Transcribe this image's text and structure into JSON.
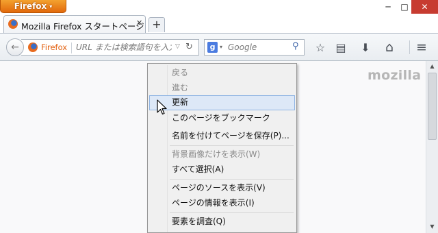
{
  "app_menu": {
    "label": "Firefox",
    "arrow": "▾"
  },
  "window_controls": {
    "minimize": "─",
    "maximize": "□",
    "close": "✕"
  },
  "tabs": [
    {
      "title": "Mozilla Firefox スタートページ",
      "close": "✕",
      "icon": "firefox-icon"
    }
  ],
  "new_tab": "+",
  "navbar": {
    "back": "←",
    "identity_label": "Firefox",
    "url_placeholder": "URL または検索語句を入力",
    "url_dropdown": "▽",
    "reload": "↻",
    "search_engine_letter": "g",
    "search_engine_dropdown": "▾",
    "search_placeholder": "Google",
    "search_go": "⚲",
    "buttons": [
      {
        "name": "bookmark-star",
        "glyph": "☆"
      },
      {
        "name": "bookmarks-menu",
        "glyph": "▤"
      },
      {
        "name": "downloads",
        "glyph": "⬇"
      },
      {
        "name": "home",
        "glyph": "⌂"
      },
      {
        "name": "menu",
        "glyph": "≡"
      }
    ]
  },
  "content": {
    "brand": "mozilla"
  },
  "scrollbar": {
    "up": "▲",
    "down": "▼"
  },
  "context_menu": {
    "items": [
      {
        "label": "戻る",
        "disabled": true
      },
      {
        "label": "進む",
        "disabled": true
      },
      {
        "label": "更新",
        "hover": true
      },
      {
        "label": "このページをブックマーク"
      },
      {
        "label": "名前を付けてページを保存(P)..."
      },
      {
        "label": "背景画像だけを表示(W)",
        "disabled": true
      },
      {
        "label": "すべて選択(A)"
      },
      {
        "label": "ページのソースを表示(V)"
      },
      {
        "label": "ページの情報を表示(I)"
      },
      {
        "label": "要素を調査(Q)"
      }
    ]
  }
}
